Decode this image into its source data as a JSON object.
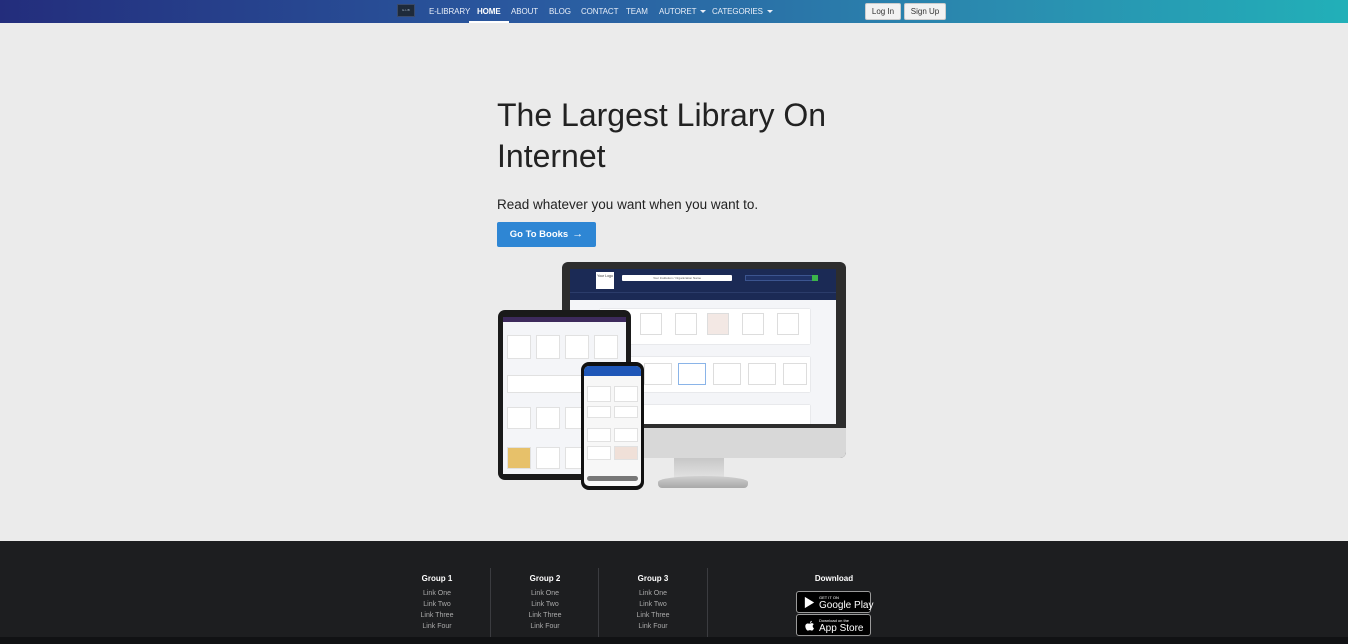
{
  "nav": {
    "logo_text": "E-LIB",
    "links": [
      {
        "label": "E-LIBRARY"
      },
      {
        "label": "HOME"
      },
      {
        "label": "ABOUT"
      },
      {
        "label": "BLOG"
      },
      {
        "label": "CONTACT"
      },
      {
        "label": "TEAM"
      },
      {
        "label": "AUTORET"
      },
      {
        "label": "CATEGORIES"
      }
    ],
    "login_label": "Log In",
    "signup_label": "Sign Up"
  },
  "hero": {
    "title": "The Largest Library On Internet",
    "subtitle": "Read whatever you want when you want to.",
    "cta_label": "Go To Books",
    "cta_arrow": "→"
  },
  "mockup": {
    "screen_logo": "Your Logo",
    "screen_search": "Your Institution / Organization Name"
  },
  "footer": {
    "groups": [
      {
        "title": "Group 1",
        "links": [
          "Link One",
          "Link Two",
          "Link Three",
          "Link Four"
        ]
      },
      {
        "title": "Group 2",
        "links": [
          "Link One",
          "Link Two",
          "Link Three",
          "Link Four"
        ]
      },
      {
        "title": "Group 3",
        "links": [
          "Link One",
          "Link Two",
          "Link Three",
          "Link Four"
        ]
      }
    ],
    "download_title": "Download",
    "google_play": {
      "small": "GET IT ON",
      "big": "Google Play"
    },
    "app_store": {
      "small": "Download on the",
      "big": "App Store"
    }
  },
  "colors": {
    "nav_gradient_start": "#232d7c",
    "nav_gradient_end": "#22b0b8",
    "cta": "#2e86d4",
    "footer_bg": "#1d1e20",
    "page_bg": "#ebebeb"
  }
}
